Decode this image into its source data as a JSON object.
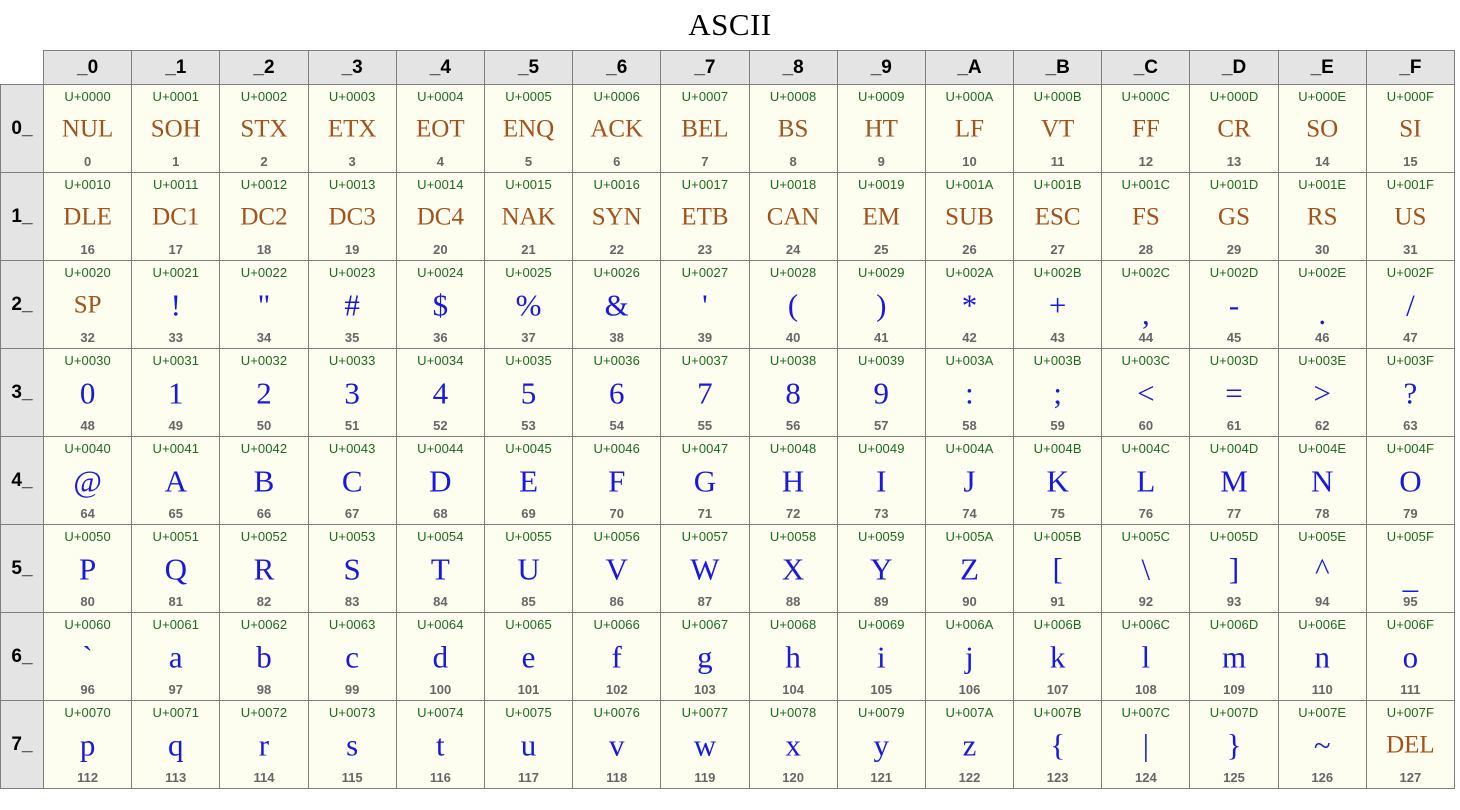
{
  "page": {
    "title": "ASCII"
  },
  "table": {
    "corner_label": "",
    "column_headers": [
      "_0",
      "_1",
      "_2",
      "_3",
      "_4",
      "_5",
      "_6",
      "_7",
      "_8",
      "_9",
      "_A",
      "_B",
      "_C",
      "_D",
      "_E",
      "_F"
    ],
    "row_headers": [
      "0_",
      "1_",
      "2_",
      "3_",
      "4_",
      "5_",
      "6_",
      "7_"
    ],
    "colors": {
      "codepoint": "#1a6b1a",
      "printable_glyph": "#1818e0",
      "control_glyph": "#a2521a",
      "decimal": "#666666",
      "cell_background": "#fdfdf0",
      "header_background": "#e4e4e4",
      "border": "#7f7f7f"
    },
    "rows": [
      {
        "header": "0_",
        "cells": [
          {
            "cp": "U+0000",
            "glyph": "NUL",
            "dec": "0",
            "kind": "control"
          },
          {
            "cp": "U+0001",
            "glyph": "SOH",
            "dec": "1",
            "kind": "control"
          },
          {
            "cp": "U+0002",
            "glyph": "STX",
            "dec": "2",
            "kind": "control"
          },
          {
            "cp": "U+0003",
            "glyph": "ETX",
            "dec": "3",
            "kind": "control"
          },
          {
            "cp": "U+0004",
            "glyph": "EOT",
            "dec": "4",
            "kind": "control"
          },
          {
            "cp": "U+0005",
            "glyph": "ENQ",
            "dec": "5",
            "kind": "control"
          },
          {
            "cp": "U+0006",
            "glyph": "ACK",
            "dec": "6",
            "kind": "control"
          },
          {
            "cp": "U+0007",
            "glyph": "BEL",
            "dec": "7",
            "kind": "control"
          },
          {
            "cp": "U+0008",
            "glyph": "BS",
            "dec": "8",
            "kind": "control"
          },
          {
            "cp": "U+0009",
            "glyph": "HT",
            "dec": "9",
            "kind": "control"
          },
          {
            "cp": "U+000A",
            "glyph": "LF",
            "dec": "10",
            "kind": "control"
          },
          {
            "cp": "U+000B",
            "glyph": "VT",
            "dec": "11",
            "kind": "control"
          },
          {
            "cp": "U+000C",
            "glyph": "FF",
            "dec": "12",
            "kind": "control"
          },
          {
            "cp": "U+000D",
            "glyph": "CR",
            "dec": "13",
            "kind": "control"
          },
          {
            "cp": "U+000E",
            "glyph": "SO",
            "dec": "14",
            "kind": "control"
          },
          {
            "cp": "U+000F",
            "glyph": "SI",
            "dec": "15",
            "kind": "control"
          }
        ]
      },
      {
        "header": "1_",
        "cells": [
          {
            "cp": "U+0010",
            "glyph": "DLE",
            "dec": "16",
            "kind": "control"
          },
          {
            "cp": "U+0011",
            "glyph": "DC1",
            "dec": "17",
            "kind": "control"
          },
          {
            "cp": "U+0012",
            "glyph": "DC2",
            "dec": "18",
            "kind": "control"
          },
          {
            "cp": "U+0013",
            "glyph": "DC3",
            "dec": "19",
            "kind": "control"
          },
          {
            "cp": "U+0014",
            "glyph": "DC4",
            "dec": "20",
            "kind": "control"
          },
          {
            "cp": "U+0015",
            "glyph": "NAK",
            "dec": "21",
            "kind": "control"
          },
          {
            "cp": "U+0016",
            "glyph": "SYN",
            "dec": "22",
            "kind": "control"
          },
          {
            "cp": "U+0017",
            "glyph": "ETB",
            "dec": "23",
            "kind": "control"
          },
          {
            "cp": "U+0018",
            "glyph": "CAN",
            "dec": "24",
            "kind": "control"
          },
          {
            "cp": "U+0019",
            "glyph": "EM",
            "dec": "25",
            "kind": "control"
          },
          {
            "cp": "U+001A",
            "glyph": "SUB",
            "dec": "26",
            "kind": "control"
          },
          {
            "cp": "U+001B",
            "glyph": "ESC",
            "dec": "27",
            "kind": "control"
          },
          {
            "cp": "U+001C",
            "glyph": "FS",
            "dec": "28",
            "kind": "control"
          },
          {
            "cp": "U+001D",
            "glyph": "GS",
            "dec": "29",
            "kind": "control"
          },
          {
            "cp": "U+001E",
            "glyph": "RS",
            "dec": "30",
            "kind": "control"
          },
          {
            "cp": "U+001F",
            "glyph": "US",
            "dec": "31",
            "kind": "control"
          }
        ]
      },
      {
        "header": "2_",
        "cells": [
          {
            "cp": "U+0020",
            "glyph": "SP",
            "dec": "32",
            "kind": "control"
          },
          {
            "cp": "U+0021",
            "glyph": "!",
            "dec": "33",
            "kind": "printable"
          },
          {
            "cp": "U+0022",
            "glyph": "\"",
            "dec": "34",
            "kind": "printable"
          },
          {
            "cp": "U+0023",
            "glyph": "#",
            "dec": "35",
            "kind": "printable"
          },
          {
            "cp": "U+0024",
            "glyph": "$",
            "dec": "36",
            "kind": "printable"
          },
          {
            "cp": "U+0025",
            "glyph": "%",
            "dec": "37",
            "kind": "printable"
          },
          {
            "cp": "U+0026",
            "glyph": "&",
            "dec": "38",
            "kind": "printable"
          },
          {
            "cp": "U+0027",
            "glyph": "'",
            "dec": "39",
            "kind": "printable"
          },
          {
            "cp": "U+0028",
            "glyph": "(",
            "dec": "40",
            "kind": "printable"
          },
          {
            "cp": "U+0029",
            "glyph": ")",
            "dec": "41",
            "kind": "printable"
          },
          {
            "cp": "U+002A",
            "glyph": "*",
            "dec": "42",
            "kind": "printable"
          },
          {
            "cp": "U+002B",
            "glyph": "+",
            "dec": "43",
            "kind": "printable"
          },
          {
            "cp": "U+002C",
            "glyph": ",",
            "dec": "44",
            "kind": "printable"
          },
          {
            "cp": "U+002D",
            "glyph": "-",
            "dec": "45",
            "kind": "printable"
          },
          {
            "cp": "U+002E",
            "glyph": ".",
            "dec": "46",
            "kind": "printable"
          },
          {
            "cp": "U+002F",
            "glyph": "/",
            "dec": "47",
            "kind": "printable"
          }
        ]
      },
      {
        "header": "3_",
        "cells": [
          {
            "cp": "U+0030",
            "glyph": "0",
            "dec": "48",
            "kind": "printable"
          },
          {
            "cp": "U+0031",
            "glyph": "1",
            "dec": "49",
            "kind": "printable"
          },
          {
            "cp": "U+0032",
            "glyph": "2",
            "dec": "50",
            "kind": "printable"
          },
          {
            "cp": "U+0033",
            "glyph": "3",
            "dec": "51",
            "kind": "printable"
          },
          {
            "cp": "U+0034",
            "glyph": "4",
            "dec": "52",
            "kind": "printable"
          },
          {
            "cp": "U+0035",
            "glyph": "5",
            "dec": "53",
            "kind": "printable"
          },
          {
            "cp": "U+0036",
            "glyph": "6",
            "dec": "54",
            "kind": "printable"
          },
          {
            "cp": "U+0037",
            "glyph": "7",
            "dec": "55",
            "kind": "printable"
          },
          {
            "cp": "U+0038",
            "glyph": "8",
            "dec": "56",
            "kind": "printable"
          },
          {
            "cp": "U+0039",
            "glyph": "9",
            "dec": "57",
            "kind": "printable"
          },
          {
            "cp": "U+003A",
            "glyph": ":",
            "dec": "58",
            "kind": "printable"
          },
          {
            "cp": "U+003B",
            "glyph": ";",
            "dec": "59",
            "kind": "printable"
          },
          {
            "cp": "U+003C",
            "glyph": "<",
            "dec": "60",
            "kind": "printable"
          },
          {
            "cp": "U+003D",
            "glyph": "=",
            "dec": "61",
            "kind": "printable"
          },
          {
            "cp": "U+003E",
            "glyph": ">",
            "dec": "62",
            "kind": "printable"
          },
          {
            "cp": "U+003F",
            "glyph": "?",
            "dec": "63",
            "kind": "printable"
          }
        ]
      },
      {
        "header": "4_",
        "cells": [
          {
            "cp": "U+0040",
            "glyph": "@",
            "dec": "64",
            "kind": "printable"
          },
          {
            "cp": "U+0041",
            "glyph": "A",
            "dec": "65",
            "kind": "printable"
          },
          {
            "cp": "U+0042",
            "glyph": "B",
            "dec": "66",
            "kind": "printable"
          },
          {
            "cp": "U+0043",
            "glyph": "C",
            "dec": "67",
            "kind": "printable"
          },
          {
            "cp": "U+0044",
            "glyph": "D",
            "dec": "68",
            "kind": "printable"
          },
          {
            "cp": "U+0045",
            "glyph": "E",
            "dec": "69",
            "kind": "printable"
          },
          {
            "cp": "U+0046",
            "glyph": "F",
            "dec": "70",
            "kind": "printable"
          },
          {
            "cp": "U+0047",
            "glyph": "G",
            "dec": "71",
            "kind": "printable"
          },
          {
            "cp": "U+0048",
            "glyph": "H",
            "dec": "72",
            "kind": "printable"
          },
          {
            "cp": "U+0049",
            "glyph": "I",
            "dec": "73",
            "kind": "printable"
          },
          {
            "cp": "U+004A",
            "glyph": "J",
            "dec": "74",
            "kind": "printable"
          },
          {
            "cp": "U+004B",
            "glyph": "K",
            "dec": "75",
            "kind": "printable"
          },
          {
            "cp": "U+004C",
            "glyph": "L",
            "dec": "76",
            "kind": "printable"
          },
          {
            "cp": "U+004D",
            "glyph": "M",
            "dec": "77",
            "kind": "printable"
          },
          {
            "cp": "U+004E",
            "glyph": "N",
            "dec": "78",
            "kind": "printable"
          },
          {
            "cp": "U+004F",
            "glyph": "O",
            "dec": "79",
            "kind": "printable"
          }
        ]
      },
      {
        "header": "5_",
        "cells": [
          {
            "cp": "U+0050",
            "glyph": "P",
            "dec": "80",
            "kind": "printable"
          },
          {
            "cp": "U+0051",
            "glyph": "Q",
            "dec": "81",
            "kind": "printable"
          },
          {
            "cp": "U+0052",
            "glyph": "R",
            "dec": "82",
            "kind": "printable"
          },
          {
            "cp": "U+0053",
            "glyph": "S",
            "dec": "83",
            "kind": "printable"
          },
          {
            "cp": "U+0054",
            "glyph": "T",
            "dec": "84",
            "kind": "printable"
          },
          {
            "cp": "U+0055",
            "glyph": "U",
            "dec": "85",
            "kind": "printable"
          },
          {
            "cp": "U+0056",
            "glyph": "V",
            "dec": "86",
            "kind": "printable"
          },
          {
            "cp": "U+0057",
            "glyph": "W",
            "dec": "87",
            "kind": "printable"
          },
          {
            "cp": "U+0058",
            "glyph": "X",
            "dec": "88",
            "kind": "printable"
          },
          {
            "cp": "U+0059",
            "glyph": "Y",
            "dec": "89",
            "kind": "printable"
          },
          {
            "cp": "U+005A",
            "glyph": "Z",
            "dec": "90",
            "kind": "printable"
          },
          {
            "cp": "U+005B",
            "glyph": "[",
            "dec": "91",
            "kind": "printable"
          },
          {
            "cp": "U+005C",
            "glyph": "\\",
            "dec": "92",
            "kind": "printable"
          },
          {
            "cp": "U+005D",
            "glyph": "]",
            "dec": "93",
            "kind": "printable"
          },
          {
            "cp": "U+005E",
            "glyph": "^",
            "dec": "94",
            "kind": "printable"
          },
          {
            "cp": "U+005F",
            "glyph": "_",
            "dec": "95",
            "kind": "printable"
          }
        ]
      },
      {
        "header": "6_",
        "cells": [
          {
            "cp": "U+0060",
            "glyph": "`",
            "dec": "96",
            "kind": "printable"
          },
          {
            "cp": "U+0061",
            "glyph": "a",
            "dec": "97",
            "kind": "printable"
          },
          {
            "cp": "U+0062",
            "glyph": "b",
            "dec": "98",
            "kind": "printable"
          },
          {
            "cp": "U+0063",
            "glyph": "c",
            "dec": "99",
            "kind": "printable"
          },
          {
            "cp": "U+0064",
            "glyph": "d",
            "dec": "100",
            "kind": "printable"
          },
          {
            "cp": "U+0065",
            "glyph": "e",
            "dec": "101",
            "kind": "printable"
          },
          {
            "cp": "U+0066",
            "glyph": "f",
            "dec": "102",
            "kind": "printable"
          },
          {
            "cp": "U+0067",
            "glyph": "g",
            "dec": "103",
            "kind": "printable"
          },
          {
            "cp": "U+0068",
            "glyph": "h",
            "dec": "104",
            "kind": "printable"
          },
          {
            "cp": "U+0069",
            "glyph": "i",
            "dec": "105",
            "kind": "printable"
          },
          {
            "cp": "U+006A",
            "glyph": "j",
            "dec": "106",
            "kind": "printable"
          },
          {
            "cp": "U+006B",
            "glyph": "k",
            "dec": "107",
            "kind": "printable"
          },
          {
            "cp": "U+006C",
            "glyph": "l",
            "dec": "108",
            "kind": "printable"
          },
          {
            "cp": "U+006D",
            "glyph": "m",
            "dec": "109",
            "kind": "printable"
          },
          {
            "cp": "U+006E",
            "glyph": "n",
            "dec": "110",
            "kind": "printable"
          },
          {
            "cp": "U+006F",
            "glyph": "o",
            "dec": "111",
            "kind": "printable"
          }
        ]
      },
      {
        "header": "7_",
        "cells": [
          {
            "cp": "U+0070",
            "glyph": "p",
            "dec": "112",
            "kind": "printable"
          },
          {
            "cp": "U+0071",
            "glyph": "q",
            "dec": "113",
            "kind": "printable"
          },
          {
            "cp": "U+0072",
            "glyph": "r",
            "dec": "114",
            "kind": "printable"
          },
          {
            "cp": "U+0073",
            "glyph": "s",
            "dec": "115",
            "kind": "printable"
          },
          {
            "cp": "U+0074",
            "glyph": "t",
            "dec": "116",
            "kind": "printable"
          },
          {
            "cp": "U+0075",
            "glyph": "u",
            "dec": "117",
            "kind": "printable"
          },
          {
            "cp": "U+0076",
            "glyph": "v",
            "dec": "118",
            "kind": "printable"
          },
          {
            "cp": "U+0077",
            "glyph": "w",
            "dec": "119",
            "kind": "printable"
          },
          {
            "cp": "U+0078",
            "glyph": "x",
            "dec": "120",
            "kind": "printable"
          },
          {
            "cp": "U+0079",
            "glyph": "y",
            "dec": "121",
            "kind": "printable"
          },
          {
            "cp": "U+007A",
            "glyph": "z",
            "dec": "122",
            "kind": "printable"
          },
          {
            "cp": "U+007B",
            "glyph": "{",
            "dec": "123",
            "kind": "printable"
          },
          {
            "cp": "U+007C",
            "glyph": "|",
            "dec": "124",
            "kind": "printable"
          },
          {
            "cp": "U+007D",
            "glyph": "}",
            "dec": "125",
            "kind": "printable"
          },
          {
            "cp": "U+007E",
            "glyph": "~",
            "dec": "126",
            "kind": "printable"
          },
          {
            "cp": "U+007F",
            "glyph": "DEL",
            "dec": "127",
            "kind": "control"
          }
        ]
      }
    ]
  }
}
